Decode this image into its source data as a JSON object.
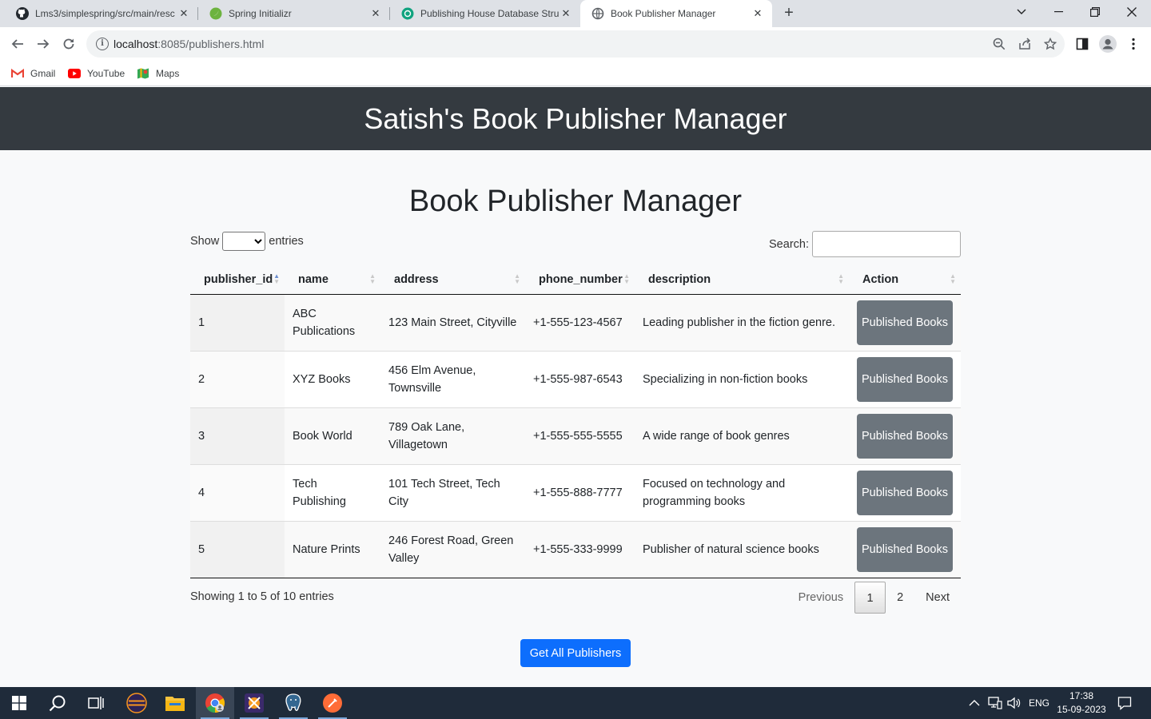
{
  "browser": {
    "tabs": [
      {
        "label": "Lms3/simplespring/src/main/resc",
        "icon": "github-icon"
      },
      {
        "label": "Spring Initializr",
        "icon": "spring-icon"
      },
      {
        "label": "Publishing House Database Struc",
        "icon": "chatgpt-icon"
      },
      {
        "label": "Book Publisher Manager",
        "icon": "globe-icon"
      }
    ],
    "url_host": "localhost",
    "url_path": ":8085/publishers.html",
    "bookmarks": [
      {
        "label": "Gmail"
      },
      {
        "label": "YouTube"
      },
      {
        "label": "Maps"
      }
    ]
  },
  "page": {
    "header": "Satish's Book Publisher Manager",
    "title": "Book Publisher Manager",
    "show_label": "Show",
    "entries_label": "entries",
    "search_label": "Search:",
    "columns": [
      "publisher_id",
      "name",
      "address",
      "phone_number",
      "description",
      "Action"
    ],
    "rows": [
      {
        "id": "1",
        "name": "ABC Publications",
        "address": "123 Main Street, Cityville",
        "phone": "+1-555-123-4567",
        "description": "Leading publisher in the fiction genre.",
        "action": "Published Books"
      },
      {
        "id": "2",
        "name": "XYZ Books",
        "address": "456 Elm Avenue, Townsville",
        "phone": "+1-555-987-6543",
        "description": "Specializing in non-fiction books",
        "action": "Published Books"
      },
      {
        "id": "3",
        "name": "Book World",
        "address": "789 Oak Lane, Villagetown",
        "phone": "+1-555-555-5555",
        "description": "A wide range of book genres",
        "action": "Published Books"
      },
      {
        "id": "4",
        "name": "Tech Publishing",
        "address": "101 Tech Street, Tech City",
        "phone": "+1-555-888-7777",
        "description": "Focused on technology and programming books",
        "action": "Published Books"
      },
      {
        "id": "5",
        "name": "Nature Prints",
        "address": "246 Forest Road, Green Valley",
        "phone": "+1-555-333-9999",
        "description": "Publisher of natural science books",
        "action": "Published Books"
      }
    ],
    "info": "Showing 1 to 5 of 10 entries",
    "pagination": {
      "previous": "Previous",
      "pages": [
        "1",
        "2"
      ],
      "next": "Next"
    },
    "get_all_button": "Get All Publishers"
  },
  "taskbar": {
    "language": "ENG",
    "time": "17:38",
    "date": "15-09-2023"
  },
  "colors": {
    "header_bg": "#343a40",
    "action_button": "#6c757d",
    "primary_button": "#0d6efd",
    "taskbar_bg": "#1f2b3a"
  }
}
